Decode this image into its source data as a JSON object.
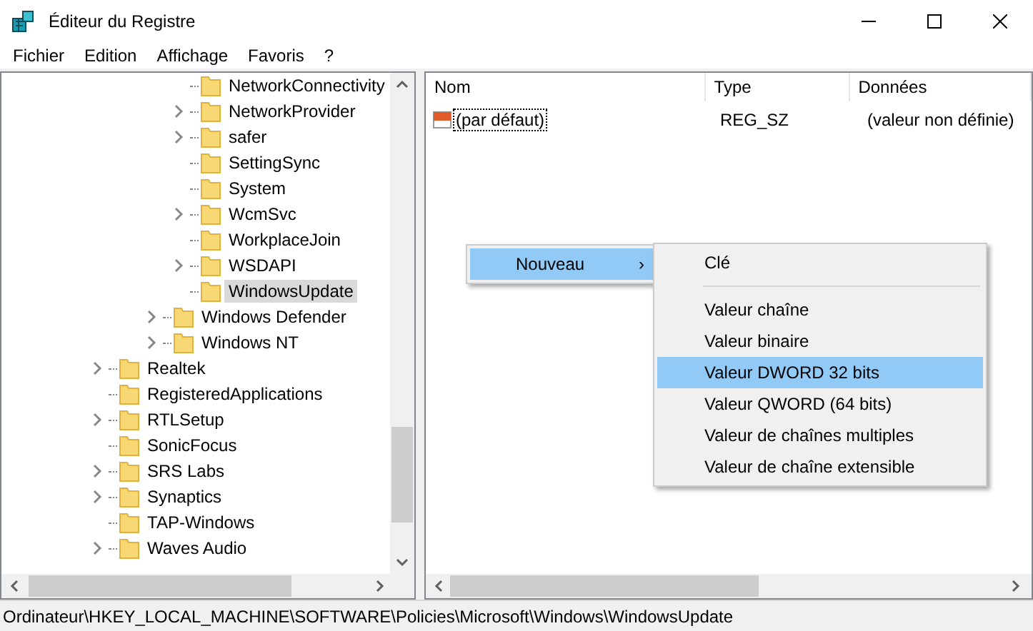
{
  "window": {
    "title": "Éditeur du Registre"
  },
  "menu": [
    "Fichier",
    "Edition",
    "Affichage",
    "Favoris",
    "?"
  ],
  "tree": [
    {
      "children": [
        {
          "children": [
            {
              "children": [
                {
                  "label": "NetworkConnectivity",
                  "expandable": false,
                  "selected": false
                },
                {
                  "label": "NetworkProvider",
                  "expandable": true,
                  "selected": false
                },
                {
                  "label": "safer",
                  "expandable": true,
                  "selected": false
                },
                {
                  "label": "SettingSync",
                  "expandable": false,
                  "selected": false
                },
                {
                  "label": "System",
                  "expandable": false,
                  "selected": false
                },
                {
                  "label": "WcmSvc",
                  "expandable": true,
                  "selected": false
                },
                {
                  "label": "WorkplaceJoin",
                  "expandable": false,
                  "selected": false
                },
                {
                  "label": "WSDAPI",
                  "expandable": true,
                  "selected": false
                },
                {
                  "label": "WindowsUpdate",
                  "expandable": false,
                  "selected": true
                }
              ]
            },
            {
              "label": "Windows Defender",
              "expandable": true,
              "selected": false
            },
            {
              "label": "Windows NT",
              "expandable": true,
              "selected": false
            }
          ]
        }
      ]
    },
    {
      "label": "Realtek",
      "expandable": true,
      "selected": false
    },
    {
      "label": "RegisteredApplications",
      "expandable": false,
      "selected": false
    },
    {
      "label": "RTLSetup",
      "expandable": true,
      "selected": false
    },
    {
      "label": "SonicFocus",
      "expandable": false,
      "selected": false
    },
    {
      "label": "SRS Labs",
      "expandable": true,
      "selected": false
    },
    {
      "label": "Synaptics",
      "expandable": true,
      "selected": false
    },
    {
      "label": "TAP-Windows",
      "expandable": false,
      "selected": false
    },
    {
      "label": "Waves Audio",
      "expandable": true,
      "selected": false
    }
  ],
  "table": {
    "columns": [
      "Nom",
      "Type",
      "Données"
    ],
    "rows": [
      {
        "name": "(par défaut)",
        "type": "REG_SZ",
        "data": "(valeur non définie)",
        "focused": true
      }
    ]
  },
  "context_menu": {
    "items": [
      {
        "label": "Nouveau",
        "selected": true,
        "arrow": "›"
      }
    ],
    "submenu": [
      {
        "label": "Clé",
        "selected": false,
        "separator_after": true
      },
      {
        "label": "Valeur chaîne",
        "selected": false,
        "separator_after": false
      },
      {
        "label": "Valeur binaire",
        "selected": false,
        "separator_after": false
      },
      {
        "label": "Valeur DWORD 32 bits",
        "selected": true,
        "separator_after": false
      },
      {
        "label": "Valeur QWORD (64 bits)",
        "selected": false,
        "separator_after": false
      },
      {
        "label": "Valeur de chaînes multiples",
        "selected": false,
        "separator_after": false
      },
      {
        "label": "Valeur de chaîne extensible",
        "selected": false,
        "separator_after": false
      }
    ]
  },
  "status_bar": "Ordinateur\\HKEY_LOCAL_MACHINE\\SOFTWARE\\Policies\\Microsoft\\Windows\\WindowsUpdate"
}
